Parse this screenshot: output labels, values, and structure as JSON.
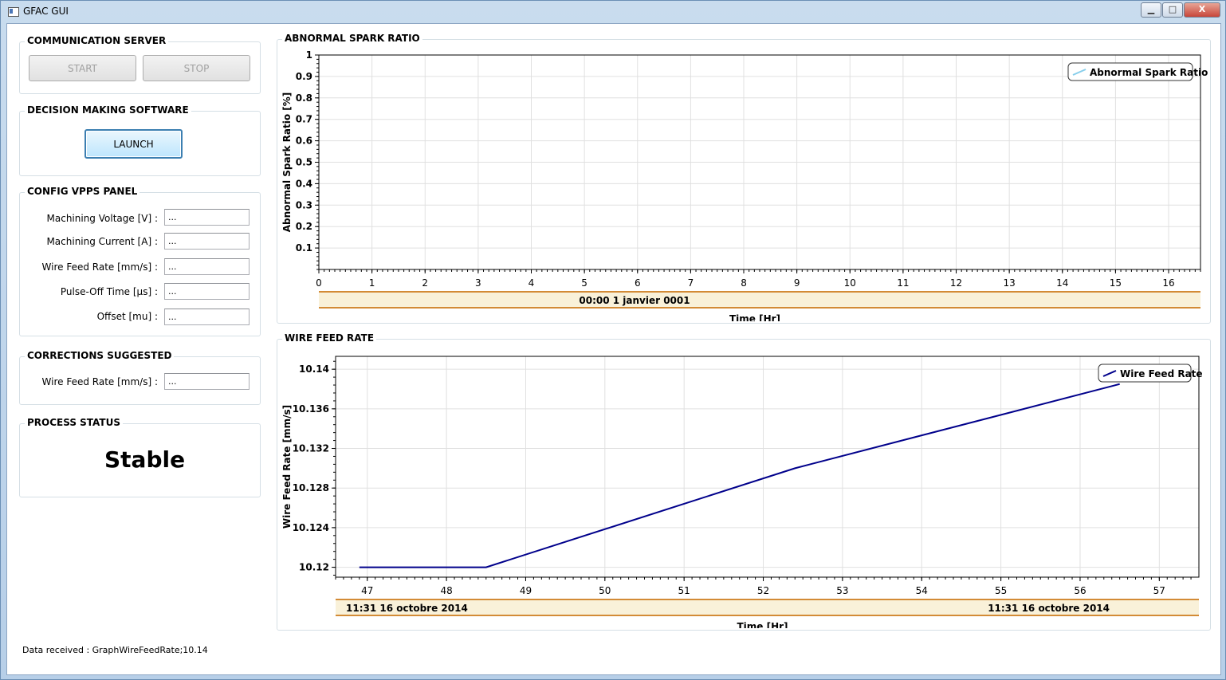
{
  "window": {
    "title": "GFAC GUI",
    "controls": {
      "minimize": "▁",
      "maximize": "□",
      "close": "X"
    }
  },
  "communication_server": {
    "title": "COMMUNICATION SERVER",
    "start_label": "START",
    "stop_label": "STOP"
  },
  "decision_software": {
    "title": "DECISION MAKING SOFTWARE",
    "launch_label": "LAUNCH"
  },
  "config_vpps": {
    "title": "CONFIG VPPS PANEL",
    "fields": [
      {
        "label": "Machining Voltage [V] :",
        "value": "..."
      },
      {
        "label": "Machining Current [A] :",
        "value": "..."
      },
      {
        "label": "Wire Feed Rate [mm/s] :",
        "value": "..."
      },
      {
        "label": "Pulse-Off Time [µs] :",
        "value": "..."
      },
      {
        "label": "Offset [mu] :",
        "value": "..."
      }
    ]
  },
  "corrections": {
    "title": "CORRECTIONS SUGGESTED",
    "field": {
      "label": "Wire Feed Rate [mm/s] :",
      "value": "..."
    }
  },
  "process_status": {
    "title": "PROCESS STATUS",
    "value": "Stable"
  },
  "footer": {
    "text": "Data received : GraphWireFeedRate;10.14"
  },
  "chart_data": [
    {
      "title": "ABNORMAL SPARK RATIO",
      "type": "line",
      "xlabel": "Time [Hr]",
      "ylabel": "Abnormal Spark Ratio [%]",
      "xlim": [
        0,
        16.6
      ],
      "ylim": [
        0,
        1
      ],
      "x_ticks": [
        "0",
        "1",
        "2",
        "3",
        "4",
        "5",
        "6",
        "7",
        "8",
        "9",
        "10",
        "11",
        "12",
        "13",
        "14",
        "15",
        "16"
      ],
      "y_ticks": [
        "0.1",
        "0.2",
        "0.3",
        "0.4",
        "0.5",
        "0.6",
        "0.7",
        "0.8",
        "0.9",
        "1"
      ],
      "date_bar": [
        "00:00 1 janvier 0001"
      ],
      "series": [
        {
          "name": "Abnormal Spark Ratio",
          "color": "#87ceeb",
          "x": [],
          "y": []
        }
      ],
      "legend_position": "top-right",
      "grid": true
    },
    {
      "title": "WIRE FEED RATE",
      "type": "line",
      "xlabel": "Time [Hr]",
      "ylabel": "Wire Feed Rate [mm/s]",
      "xlim": [
        46.6,
        57.5
      ],
      "ylim": [
        10.119,
        10.1413
      ],
      "x_ticks": [
        "47",
        "48",
        "49",
        "50",
        "51",
        "52",
        "53",
        "54",
        "55",
        "56",
        "57"
      ],
      "y_ticks": [
        "10.12",
        "10.124",
        "10.128",
        "10.132",
        "10.136",
        "10.14"
      ],
      "date_bar": [
        "11:31 16 octobre 2014",
        "11:31 16 octobre 2014"
      ],
      "series": [
        {
          "name": "Wire Feed Rate",
          "color": "#00008b",
          "x": [
            46.9,
            48.5,
            52.4,
            56.5
          ],
          "y": [
            10.12,
            10.12,
            10.13,
            10.1385
          ]
        }
      ],
      "legend_position": "top-right",
      "grid": true
    }
  ]
}
